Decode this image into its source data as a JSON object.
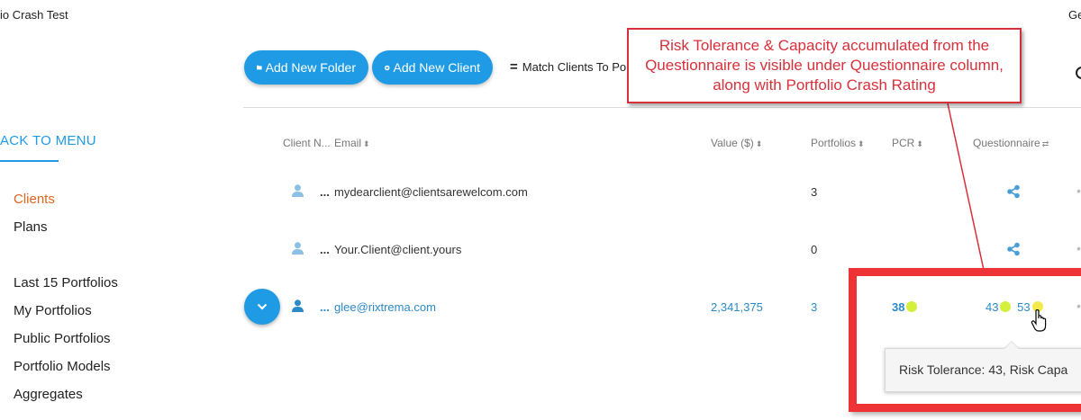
{
  "header": {
    "app_title": "io Crash Test",
    "right_fragment": "Ge"
  },
  "toolbar": {
    "add_folder_label": "Add New Folder",
    "add_client_label": "Add New Client",
    "match_label": "Match Clients To Por"
  },
  "sidebar": {
    "back_label": "ACK TO MENU",
    "items": [
      {
        "label": "Clients",
        "active": true
      },
      {
        "label": "Plans"
      },
      {
        "label": "Last 15 Portfolios"
      },
      {
        "label": "My Portfolios"
      },
      {
        "label": "Public Portfolios"
      },
      {
        "label": "Portfolio Models"
      },
      {
        "label": "Aggregates"
      }
    ]
  },
  "table": {
    "columns": [
      "Client N...",
      "Email",
      "Value ($)",
      "Portfolios",
      "PCR",
      "Questionnaire"
    ],
    "rows": [
      {
        "name": "...",
        "email": "mydearclient@clientsarewelcom.com",
        "value": "",
        "portfolios": "3",
        "pcr": "",
        "risk_tolerance": "",
        "risk_capacity": ""
      },
      {
        "name": "...",
        "email": "Your.Client@client.yours",
        "value": "",
        "portfolios": "0",
        "pcr": "",
        "risk_tolerance": "",
        "risk_capacity": ""
      },
      {
        "name": "...",
        "email": "glee@rixtrema.com",
        "value": "2,341,375",
        "portfolios": "3",
        "pcr": "38",
        "risk_tolerance": "43",
        "risk_capacity": "53"
      }
    ]
  },
  "tooltip": {
    "text": "Risk Tolerance: 43, Risk Capa"
  },
  "annotation": {
    "callout_text": "Risk Tolerance & Capacity accumulated from the Questionnaire is visible under Questionnaire column, along with Portfolio Crash Rating"
  },
  "colors": {
    "accent": "#1e9be4",
    "active_nav": "#e0651f",
    "link": "#2b8ac8",
    "rating_green": "#d4f03c",
    "rating_yellow": "#f3ea4a",
    "annotation_red": "#d6313b",
    "highlight_red": "#ee3336"
  }
}
